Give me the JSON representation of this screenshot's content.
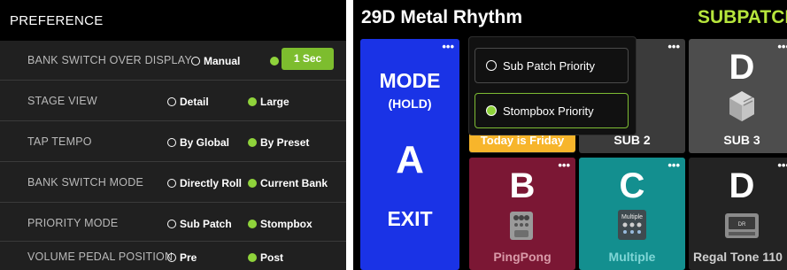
{
  "preference": {
    "title": "PREFERENCE",
    "rows": [
      {
        "label": "BANK SWITCH OVER DISPLAY",
        "options": [
          "Manual"
        ],
        "button": "1 Sec",
        "selected": "button"
      },
      {
        "label": "STAGE VIEW",
        "options": [
          "Detail",
          "Large"
        ],
        "selected": 1
      },
      {
        "label": "TAP TEMPO",
        "options": [
          "By Global",
          "By Preset"
        ],
        "selected": 1
      },
      {
        "label": "BANK SWITCH MODE",
        "options": [
          "Directly Roll",
          "Current Bank"
        ],
        "selected": 1
      },
      {
        "label": "PRIORITY MODE",
        "options": [
          "Sub Patch",
          "Stompbox"
        ],
        "selected": 1
      },
      {
        "label": "VOLUME PEDAL POSITION",
        "options": [
          "Pre",
          "Post"
        ],
        "selected": 1
      }
    ],
    "colors": {
      "accent": "#8fd33b",
      "panel": "#202020",
      "header": "#000000"
    }
  },
  "stage": {
    "preset_title": "29D Metal Rhythm",
    "mode_title": "SUBPATCH",
    "mode_tile": {
      "line1": "MODE",
      "line2": "(HOLD)",
      "letter": "A",
      "exit": "EXIT"
    },
    "popup": {
      "options": [
        "Sub Patch Priority",
        "Stompbox Priority"
      ],
      "selected": 1
    },
    "tiles": [
      {
        "id": "today",
        "label": "Today is Friday",
        "color": "#f7b52b"
      },
      {
        "id": "sub2",
        "name": "SUB 2"
      },
      {
        "id": "d1",
        "letter": "D",
        "name": "SUB 3"
      },
      {
        "id": "b",
        "letter": "B",
        "name": "PingPong",
        "color": "#7b1734"
      },
      {
        "id": "c",
        "letter": "C",
        "name": "Multiple",
        "icon_text": "Multiple",
        "color": "#138f8f"
      },
      {
        "id": "d2",
        "letter": "D",
        "name": "Regal Tone 110",
        "icon_text": "DR"
      }
    ],
    "dots": "•••",
    "colors": {
      "mode_tile": "#1a33e6",
      "subpatch": "#b6e53c"
    }
  }
}
